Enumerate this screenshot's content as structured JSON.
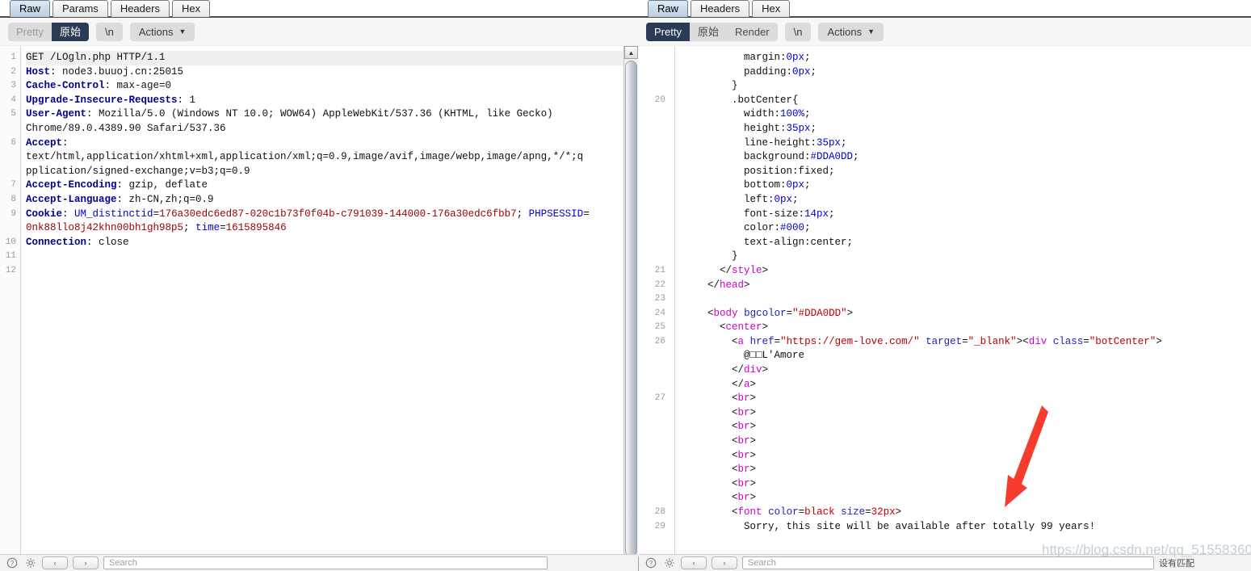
{
  "request_panel": {
    "tabs": [
      {
        "label": "Raw",
        "active": true
      },
      {
        "label": "Params",
        "active": false
      },
      {
        "label": "Headers",
        "active": false
      },
      {
        "label": "Hex",
        "active": false
      }
    ],
    "actions": {
      "pretty_label": "Pretty",
      "raw_label": "原始",
      "newline_label": "\\n",
      "actions_label": "Actions",
      "caret": "⌄"
    },
    "gutter": [
      "1",
      "2",
      "3",
      "4",
      "5",
      "",
      "6",
      "",
      "",
      "7",
      "8",
      "9",
      "",
      "10",
      "11",
      "12"
    ],
    "lines": [
      {
        "n": 1,
        "segments": [
          {
            "t": "GET /LOgln.php HTTP/1.1",
            "c": "k-plain"
          }
        ]
      },
      {
        "n": 2,
        "segments": [
          {
            "t": "Host",
            "c": "k-hdr"
          },
          {
            "t": ": node3.buuoj.cn:25015",
            "c": "k-plain"
          }
        ]
      },
      {
        "n": 3,
        "segments": [
          {
            "t": "Cache-Control",
            "c": "k-hdr"
          },
          {
            "t": ": max-age=0",
            "c": "k-plain"
          }
        ]
      },
      {
        "n": 4,
        "segments": [
          {
            "t": "Upgrade-Insecure-Requests",
            "c": "k-hdr"
          },
          {
            "t": ": 1",
            "c": "k-plain"
          }
        ]
      },
      {
        "n": 5,
        "segments": [
          {
            "t": "User-Agent",
            "c": "k-hdr"
          },
          {
            "t": ": Mozilla/5.0 (Windows NT 10.0; WOW64) AppleWebKit/537.36 (KHTML, like Gecko)",
            "c": "k-plain"
          }
        ]
      },
      {
        "n": null,
        "segments": [
          {
            "t": "Chrome/89.0.4389.90 Safari/537.36",
            "c": "k-plain"
          }
        ]
      },
      {
        "n": 6,
        "segments": [
          {
            "t": "Accept",
            "c": "k-hdr"
          },
          {
            "t": ":",
            "c": "k-plain"
          }
        ]
      },
      {
        "n": null,
        "segments": [
          {
            "t": "text/html,application/xhtml+xml,application/xml;q=0.9,image/avif,image/webp,image/apng,*/*;q",
            "c": "k-plain"
          }
        ]
      },
      {
        "n": null,
        "segments": [
          {
            "t": "pplication/signed-exchange;v=b3;q=0.9",
            "c": "k-plain"
          }
        ]
      },
      {
        "n": 7,
        "segments": [
          {
            "t": "Accept-Encoding",
            "c": "k-hdr"
          },
          {
            "t": ": gzip, deflate",
            "c": "k-plain"
          }
        ]
      },
      {
        "n": 8,
        "segments": [
          {
            "t": "Accept-Language",
            "c": "k-hdr"
          },
          {
            "t": ": zh-CN,zh;q=0.9",
            "c": "k-plain"
          }
        ]
      },
      {
        "n": 9,
        "segments": [
          {
            "t": "Cookie",
            "c": "k-hdr"
          },
          {
            "t": ": ",
            "c": "k-plain"
          },
          {
            "t": "UM_distinctid",
            "c": "k-blue"
          },
          {
            "t": "=",
            "c": "k-plain"
          },
          {
            "t": "176a30edc6ed87-020c1b73f0f04b-c791039-144000-176a30edc6fbb7",
            "c": "k-red"
          },
          {
            "t": "; ",
            "c": "k-plain"
          },
          {
            "t": "PHPSESSID",
            "c": "k-blue"
          },
          {
            "t": "=",
            "c": "k-plain"
          }
        ]
      },
      {
        "n": null,
        "segments": [
          {
            "t": "0nk88llo8j42khn00bh1gh98p5",
            "c": "k-red"
          },
          {
            "t": "; ",
            "c": "k-plain"
          },
          {
            "t": "time",
            "c": "k-blue"
          },
          {
            "t": "=",
            "c": "k-plain"
          },
          {
            "t": "1615895846",
            "c": "k-red"
          }
        ]
      },
      {
        "n": 10,
        "segments": [
          {
            "t": "Connection",
            "c": "k-hdr"
          },
          {
            "t": ": close",
            "c": "k-plain"
          }
        ]
      },
      {
        "n": 11,
        "segments": []
      },
      {
        "n": 12,
        "segments": []
      }
    ]
  },
  "response_panel": {
    "tabs": [
      {
        "label": "Raw",
        "active": true
      },
      {
        "label": "Headers",
        "active": false
      },
      {
        "label": "Hex",
        "active": false
      }
    ],
    "actions": {
      "pretty_label": "Pretty",
      "raw_label": "原始",
      "render_label": "Render",
      "newline_label": "\\n",
      "actions_label": "Actions",
      "caret": "⌄"
    },
    "lines": [
      {
        "n": null,
        "indent": 10,
        "segments": [
          {
            "t": "margin:",
            "c": "k-plain"
          },
          {
            "t": "0px",
            "c": "k-blue"
          },
          {
            "t": ";",
            "c": "k-plain"
          }
        ]
      },
      {
        "n": null,
        "indent": 10,
        "segments": [
          {
            "t": "padding:",
            "c": "k-plain"
          },
          {
            "t": "0px",
            "c": "k-blue"
          },
          {
            "t": ";",
            "c": "k-plain"
          }
        ]
      },
      {
        "n": null,
        "indent": 8,
        "segments": [
          {
            "t": "}",
            "c": "k-plain"
          }
        ]
      },
      {
        "n": 20,
        "indent": 8,
        "segments": [
          {
            "t": ".botCenter{",
            "c": "k-plain"
          }
        ]
      },
      {
        "n": null,
        "indent": 10,
        "segments": [
          {
            "t": "width:",
            "c": "k-plain"
          },
          {
            "t": "100%",
            "c": "k-blue"
          },
          {
            "t": ";",
            "c": "k-plain"
          }
        ]
      },
      {
        "n": null,
        "indent": 10,
        "segments": [
          {
            "t": "height:",
            "c": "k-plain"
          },
          {
            "t": "35px",
            "c": "k-blue"
          },
          {
            "t": ";",
            "c": "k-plain"
          }
        ]
      },
      {
        "n": null,
        "indent": 10,
        "segments": [
          {
            "t": "line-height:",
            "c": "k-plain"
          },
          {
            "t": "35px",
            "c": "k-blue"
          },
          {
            "t": ";",
            "c": "k-plain"
          }
        ]
      },
      {
        "n": null,
        "indent": 10,
        "segments": [
          {
            "t": "background:",
            "c": "k-plain"
          },
          {
            "t": "#DDA0DD",
            "c": "k-blue"
          },
          {
            "t": ";",
            "c": "k-plain"
          }
        ]
      },
      {
        "n": null,
        "indent": 10,
        "segments": [
          {
            "t": "position:fixed;",
            "c": "k-plain"
          }
        ]
      },
      {
        "n": null,
        "indent": 10,
        "segments": [
          {
            "t": "bottom:",
            "c": "k-plain"
          },
          {
            "t": "0px",
            "c": "k-blue"
          },
          {
            "t": ";",
            "c": "k-plain"
          }
        ]
      },
      {
        "n": null,
        "indent": 10,
        "segments": [
          {
            "t": "left:",
            "c": "k-plain"
          },
          {
            "t": "0px",
            "c": "k-blue"
          },
          {
            "t": ";",
            "c": "k-plain"
          }
        ]
      },
      {
        "n": null,
        "indent": 10,
        "segments": [
          {
            "t": "font-size:",
            "c": "k-plain"
          },
          {
            "t": "14px",
            "c": "k-blue"
          },
          {
            "t": ";",
            "c": "k-plain"
          }
        ]
      },
      {
        "n": null,
        "indent": 10,
        "segments": [
          {
            "t": "color:",
            "c": "k-plain"
          },
          {
            "t": "#000",
            "c": "k-blue"
          },
          {
            "t": ";",
            "c": "k-plain"
          }
        ]
      },
      {
        "n": null,
        "indent": 10,
        "segments": [
          {
            "t": "text-align:center;",
            "c": "k-plain"
          }
        ]
      },
      {
        "n": null,
        "indent": 8,
        "segments": [
          {
            "t": "}",
            "c": "k-plain"
          }
        ]
      },
      {
        "n": 21,
        "indent": 6,
        "segments": [
          {
            "t": "</",
            "c": "k-plain"
          },
          {
            "t": "style",
            "c": "k-tag"
          },
          {
            "t": ">",
            "c": "k-plain"
          }
        ]
      },
      {
        "n": 22,
        "indent": 4,
        "segments": [
          {
            "t": "</",
            "c": "k-plain"
          },
          {
            "t": "head",
            "c": "k-tag"
          },
          {
            "t": ">",
            "c": "k-plain"
          }
        ]
      },
      {
        "n": 23,
        "indent": 0,
        "segments": []
      },
      {
        "n": 24,
        "indent": 4,
        "segments": [
          {
            "t": "<",
            "c": "k-plain"
          },
          {
            "t": "body",
            "c": "k-tag"
          },
          {
            "t": " ",
            "c": "k-plain"
          },
          {
            "t": "bgcolor",
            "c": "k-attr"
          },
          {
            "t": "=",
            "c": "k-plain"
          },
          {
            "t": "\"#DDA0DD\"",
            "c": "k-str"
          },
          {
            "t": ">",
            "c": "k-plain"
          }
        ]
      },
      {
        "n": 25,
        "indent": 6,
        "segments": [
          {
            "t": "<",
            "c": "k-plain"
          },
          {
            "t": "center",
            "c": "k-tag"
          },
          {
            "t": ">",
            "c": "k-plain"
          }
        ]
      },
      {
        "n": 26,
        "indent": 8,
        "segments": [
          {
            "t": "<",
            "c": "k-plain"
          },
          {
            "t": "a",
            "c": "k-tag"
          },
          {
            "t": " ",
            "c": "k-plain"
          },
          {
            "t": "href",
            "c": "k-attr"
          },
          {
            "t": "=",
            "c": "k-plain"
          },
          {
            "t": "\"https://gem-love.com/\"",
            "c": "k-str"
          },
          {
            "t": " ",
            "c": "k-plain"
          },
          {
            "t": "target",
            "c": "k-attr"
          },
          {
            "t": "=",
            "c": "k-plain"
          },
          {
            "t": "\"_blank\"",
            "c": "k-str"
          },
          {
            "t": "><",
            "c": "k-plain"
          },
          {
            "t": "div",
            "c": "k-tag"
          },
          {
            "t": " ",
            "c": "k-plain"
          },
          {
            "t": "class",
            "c": "k-attr"
          },
          {
            "t": "=",
            "c": "k-plain"
          },
          {
            "t": "\"botCenter\"",
            "c": "k-str"
          },
          {
            "t": ">",
            "c": "k-plain"
          }
        ]
      },
      {
        "n": null,
        "indent": 10,
        "segments": [
          {
            "t": "@□□L'Amore",
            "c": "k-plain"
          }
        ]
      },
      {
        "n": null,
        "indent": 8,
        "segments": [
          {
            "t": "</",
            "c": "k-plain"
          },
          {
            "t": "div",
            "c": "k-tag"
          },
          {
            "t": ">",
            "c": "k-plain"
          }
        ]
      },
      {
        "n": null,
        "indent": 8,
        "segments": [
          {
            "t": "</",
            "c": "k-plain"
          },
          {
            "t": "a",
            "c": "k-tag"
          },
          {
            "t": ">",
            "c": "k-plain"
          }
        ]
      },
      {
        "n": 27,
        "indent": 8,
        "segments": [
          {
            "t": "<",
            "c": "k-plain"
          },
          {
            "t": "br",
            "c": "k-tag"
          },
          {
            "t": ">",
            "c": "k-plain"
          }
        ]
      },
      {
        "n": null,
        "indent": 8,
        "segments": [
          {
            "t": "<",
            "c": "k-plain"
          },
          {
            "t": "br",
            "c": "k-tag"
          },
          {
            "t": ">",
            "c": "k-plain"
          }
        ]
      },
      {
        "n": null,
        "indent": 8,
        "segments": [
          {
            "t": "<",
            "c": "k-plain"
          },
          {
            "t": "br",
            "c": "k-tag"
          },
          {
            "t": ">",
            "c": "k-plain"
          }
        ]
      },
      {
        "n": null,
        "indent": 8,
        "segments": [
          {
            "t": "<",
            "c": "k-plain"
          },
          {
            "t": "br",
            "c": "k-tag"
          },
          {
            "t": ">",
            "c": "k-plain"
          }
        ]
      },
      {
        "n": null,
        "indent": 8,
        "segments": [
          {
            "t": "<",
            "c": "k-plain"
          },
          {
            "t": "br",
            "c": "k-tag"
          },
          {
            "t": ">",
            "c": "k-plain"
          }
        ]
      },
      {
        "n": null,
        "indent": 8,
        "segments": [
          {
            "t": "<",
            "c": "k-plain"
          },
          {
            "t": "br",
            "c": "k-tag"
          },
          {
            "t": ">",
            "c": "k-plain"
          }
        ]
      },
      {
        "n": null,
        "indent": 8,
        "segments": [
          {
            "t": "<",
            "c": "k-plain"
          },
          {
            "t": "br",
            "c": "k-tag"
          },
          {
            "t": ">",
            "c": "k-plain"
          }
        ]
      },
      {
        "n": null,
        "indent": 8,
        "segments": [
          {
            "t": "<",
            "c": "k-plain"
          },
          {
            "t": "br",
            "c": "k-tag"
          },
          {
            "t": ">",
            "c": "k-plain"
          }
        ]
      },
      {
        "n": 28,
        "indent": 8,
        "segments": [
          {
            "t": "<",
            "c": "k-plain"
          },
          {
            "t": "font",
            "c": "k-tag"
          },
          {
            "t": " ",
            "c": "k-plain"
          },
          {
            "t": "color",
            "c": "k-attr"
          },
          {
            "t": "=",
            "c": "k-plain"
          },
          {
            "t": "black",
            "c": "k-str"
          },
          {
            "t": " ",
            "c": "k-plain"
          },
          {
            "t": "size",
            "c": "k-attr"
          },
          {
            "t": "=",
            "c": "k-plain"
          },
          {
            "t": "32px",
            "c": "k-str"
          },
          {
            "t": ">",
            "c": "k-plain"
          }
        ]
      },
      {
        "n": 29,
        "indent": 10,
        "segments": [
          {
            "t": "Sorry, this site will be available after totally 99 years!",
            "c": "k-plain"
          }
        ]
      }
    ]
  },
  "footer": {
    "help_icon": "question-mark-icon",
    "settings_icon": "gear-icon",
    "prev_label": "‹",
    "next_label": "›",
    "search_placeholder": "Search",
    "match_note": "设有匹配"
  },
  "watermark": {
    "text": "https://blog.csdn.net/qq_51558360"
  },
  "annotation": {
    "arrow_color": "#f63b2f",
    "arrow_name": "red-annotation-arrow"
  }
}
